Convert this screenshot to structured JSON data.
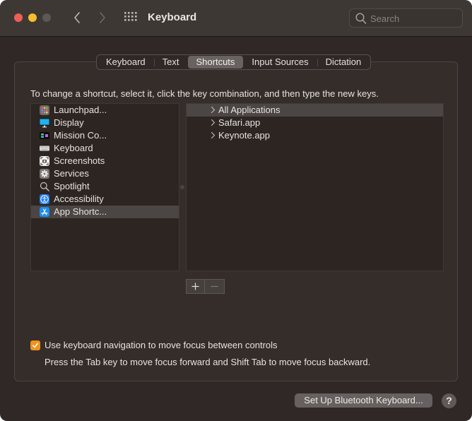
{
  "window": {
    "title": "Keyboard",
    "search_placeholder": "Search"
  },
  "tabs": [
    {
      "label": "Keyboard",
      "active": false
    },
    {
      "label": "Text",
      "active": false
    },
    {
      "label": "Shortcuts",
      "active": true
    },
    {
      "label": "Input Sources",
      "active": false
    },
    {
      "label": "Dictation",
      "active": false
    }
  ],
  "instructions": "To change a shortcut, select it, click the key combination, and then type the new keys.",
  "categories": [
    {
      "label": "Launchpad...",
      "icon": "launchpad-icon",
      "selected": false
    },
    {
      "label": "Display",
      "icon": "display-icon",
      "selected": false
    },
    {
      "label": "Mission Co...",
      "icon": "mission-control-icon",
      "selected": false
    },
    {
      "label": "Keyboard",
      "icon": "keyboard-icon",
      "selected": false
    },
    {
      "label": "Screenshots",
      "icon": "screenshot-icon",
      "selected": false
    },
    {
      "label": "Services",
      "icon": "gear-icon",
      "selected": false
    },
    {
      "label": "Spotlight",
      "icon": "search-icon",
      "selected": false
    },
    {
      "label": "Accessibility",
      "icon": "accessibility-icon",
      "selected": false
    },
    {
      "label": "App Shortc...",
      "icon": "app-store-icon",
      "selected": true
    }
  ],
  "shortcut_groups": [
    {
      "label": "All Applications",
      "selected": true
    },
    {
      "label": "Safari.app",
      "selected": false
    },
    {
      "label": "Keynote.app",
      "selected": false
    }
  ],
  "add_remove": {
    "add": "+",
    "remove": "−"
  },
  "keyboard_navigation": {
    "label": "Use keyboard navigation to move focus between controls",
    "checked": true,
    "hint": "Press the Tab key to move focus forward and Shift Tab to move focus backward."
  },
  "footer": {
    "bluetooth_button": "Set Up Bluetooth Keyboard...",
    "help_button": "?"
  },
  "colors": {
    "accent": "#f0921e",
    "close": "#ee5e57",
    "minimize": "#f4bf30"
  }
}
